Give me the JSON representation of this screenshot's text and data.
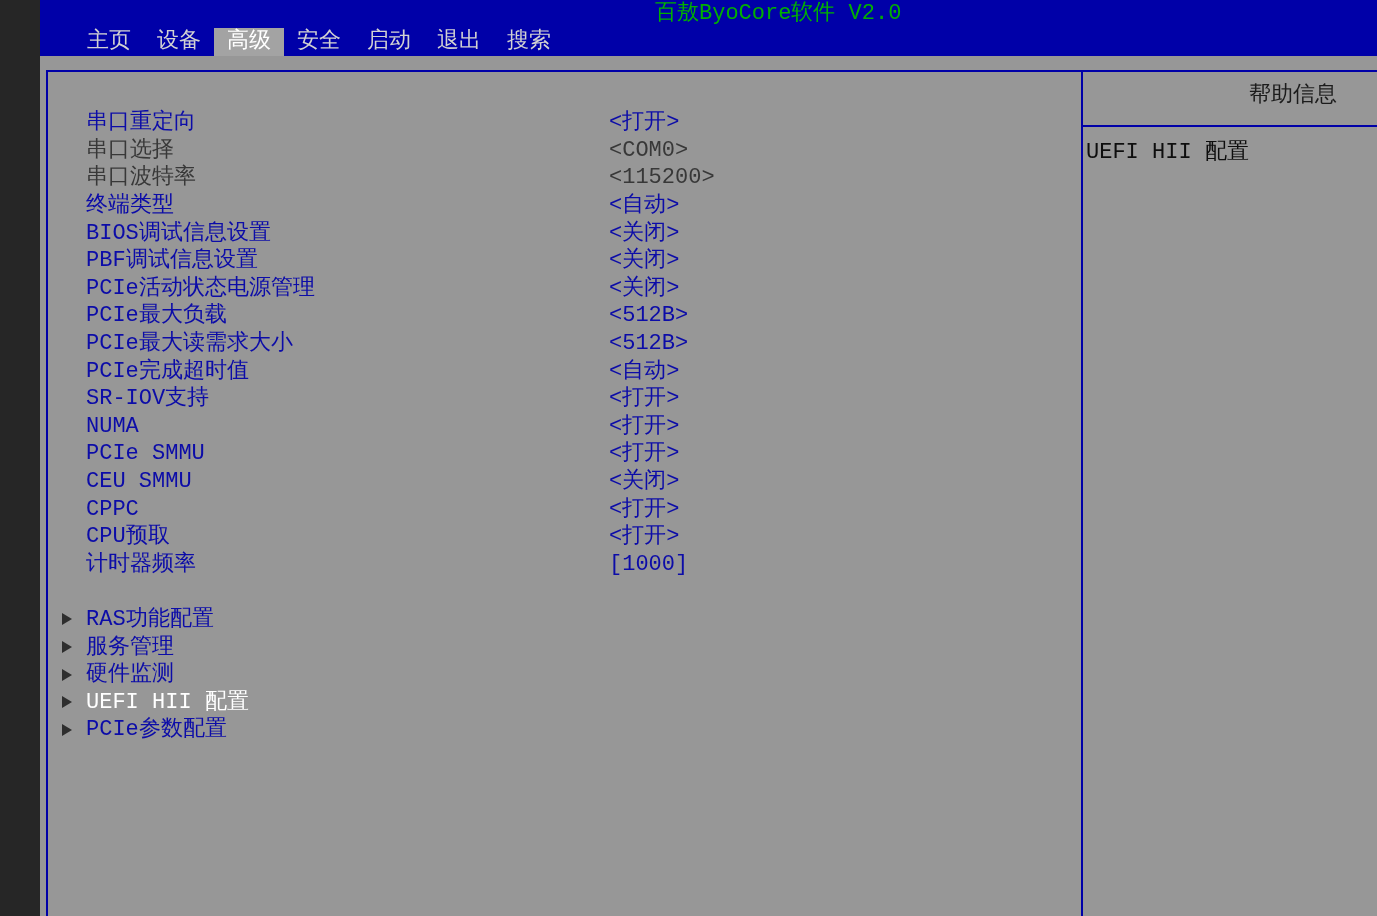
{
  "header": {
    "title": "百敖ByoCore软件 V2.0"
  },
  "tabs": [
    {
      "label": "主页",
      "selected": false
    },
    {
      "label": "设备",
      "selected": false
    },
    {
      "label": "高级",
      "selected": true
    },
    {
      "label": "安全",
      "selected": false
    },
    {
      "label": "启动",
      "selected": false
    },
    {
      "label": "退出",
      "selected": false
    },
    {
      "label": "搜索",
      "selected": false
    }
  ],
  "settings": [
    {
      "label": "串口重定向",
      "value": "<打开>",
      "disabled": false
    },
    {
      "label": "串口选择",
      "value": "<COM0>",
      "disabled": true
    },
    {
      "label": "串口波特率",
      "value": "<115200>",
      "disabled": true
    },
    {
      "label": "终端类型",
      "value": "<自动>",
      "disabled": false
    },
    {
      "label": "BIOS调试信息设置",
      "value": "<关闭>",
      "disabled": false
    },
    {
      "label": "PBF调试信息设置",
      "value": "<关闭>",
      "disabled": false
    },
    {
      "label": "PCIe活动状态电源管理",
      "value": "<关闭>",
      "disabled": false
    },
    {
      "label": "PCIe最大负载",
      "value": "<512B>",
      "disabled": false
    },
    {
      "label": "PCIe最大读需求大小",
      "value": "<512B>",
      "disabled": false
    },
    {
      "label": "PCIe完成超时值",
      "value": "<自动>",
      "disabled": false
    },
    {
      "label": "SR-IOV支持",
      "value": "<打开>",
      "disabled": false
    },
    {
      "label": "NUMA",
      "value": "<打开>",
      "disabled": false
    },
    {
      "label": "PCIe SMMU",
      "value": "<打开>",
      "disabled": false
    },
    {
      "label": "CEU SMMU",
      "value": "<关闭>",
      "disabled": false
    },
    {
      "label": "CPPC",
      "value": "<打开>",
      "disabled": false
    },
    {
      "label": "CPU预取",
      "value": "<打开>",
      "disabled": false
    },
    {
      "label": "计时器频率",
      "value": "[1000]",
      "disabled": false
    }
  ],
  "submenus": [
    {
      "label": "RAS功能配置",
      "selected": false
    },
    {
      "label": "服务管理",
      "selected": false
    },
    {
      "label": "硬件监测",
      "selected": false
    },
    {
      "label": "UEFI HII 配置",
      "selected": true
    },
    {
      "label": "PCIe参数配置",
      "selected": false
    }
  ],
  "help": {
    "title": "帮助信息",
    "text": "UEFI HII 配置"
  }
}
